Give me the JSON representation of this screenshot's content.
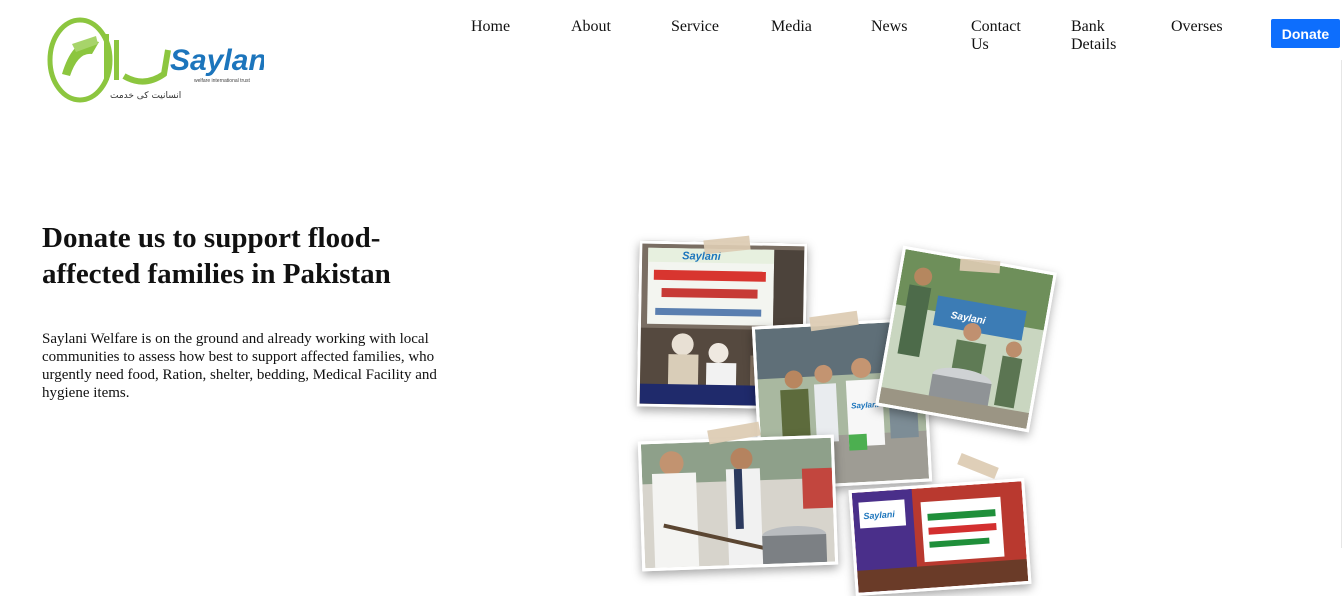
{
  "logo": {
    "brand_latin": "Saylani",
    "brand_urdu": "سیلانی",
    "tagline": "welfare international trust",
    "slogan_urdu": "انسانیت کی خدمت",
    "colors": {
      "green": "#8cc63f",
      "blue": "#1c75bc"
    }
  },
  "nav": {
    "items": [
      {
        "label": "Home"
      },
      {
        "label": "About"
      },
      {
        "label": "Service"
      },
      {
        "label": "Media"
      },
      {
        "label": "News"
      },
      {
        "label": "Contact Us"
      },
      {
        "label": "Bank Details"
      },
      {
        "label": "Overses"
      }
    ],
    "donate_label": "Donate",
    "donate_color": "#0d6efd"
  },
  "hero": {
    "title": "Donate us to support flood-affected families in Pakistan",
    "text": "Saylani Welfare is on the ground and already working with local communities to assess how best to support affected families, who urgently need food, Ration, shelter, bedding, Medical Facility and hygiene items."
  },
  "collage": {
    "photos": [
      {
        "name": "medical-camp-photo",
        "banner_text": "Saylani"
      },
      {
        "name": "army-volunteers-photo",
        "banner_text": "Saylani"
      },
      {
        "name": "cooking-pot-photo",
        "banner_text": "Saylani"
      },
      {
        "name": "food-distribution-photo",
        "banner_text": ""
      },
      {
        "name": "banner-display-photo",
        "banner_text": "Saylani"
      }
    ]
  }
}
